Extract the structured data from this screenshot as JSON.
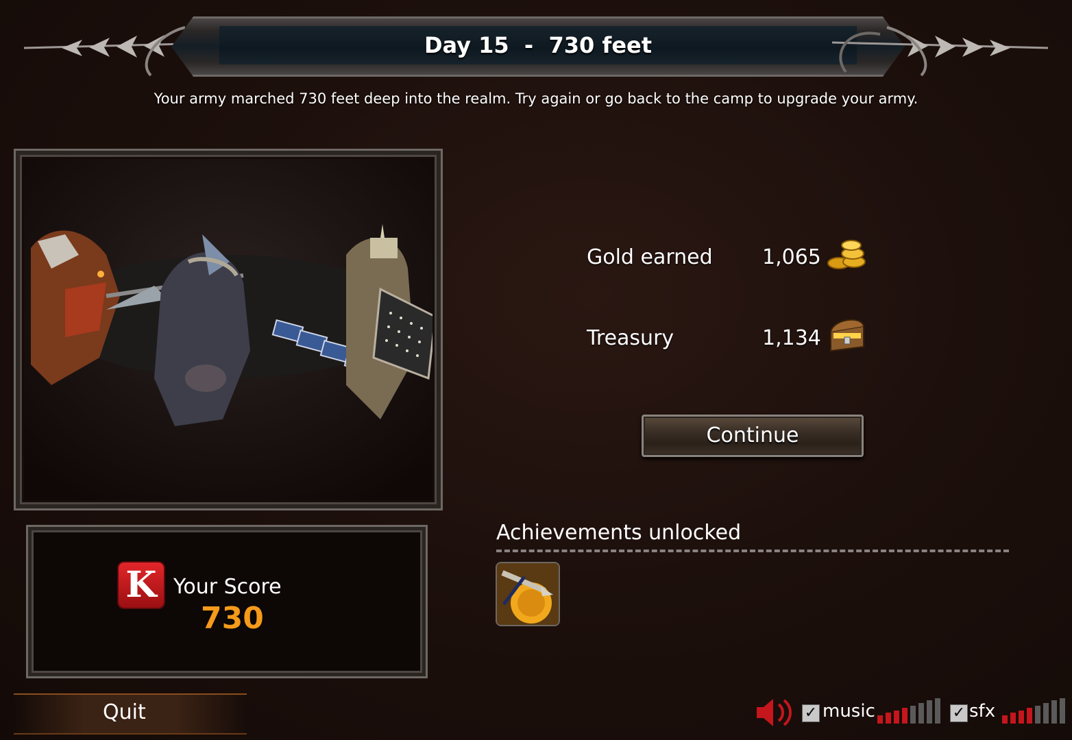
{
  "header": {
    "title": "Day 15  -  730 feet",
    "subtitle": "Your army marched 730 feet deep into the realm. Try again or go back to the camp to upgrade your army."
  },
  "score": {
    "logo_letter": "K",
    "label": "Your Score",
    "value": "730"
  },
  "stats": {
    "gold_label": "Gold earned",
    "gold_value": "1,065",
    "gold_icon": "gold-coins-icon",
    "treasury_label": "Treasury",
    "treasury_value": "1,134",
    "treasury_icon": "treasure-chest-icon"
  },
  "buttons": {
    "continue": "Continue",
    "quit": "Quit"
  },
  "achievements": {
    "title": "Achievements unlocked",
    "badges": [
      "achievement-badge-icon"
    ]
  },
  "audio": {
    "speaker_icon": "speaker-icon",
    "music_label": "music",
    "music_checked": true,
    "music_level": 0.5,
    "sfx_label": "sfx",
    "sfx_checked": true,
    "sfx_level": 0.5
  },
  "colors": {
    "score_value": "#f59a1a",
    "volume_active": "#c4161c",
    "volume_inactive": "#5a5a5a",
    "logo_red": "#e2262a"
  }
}
